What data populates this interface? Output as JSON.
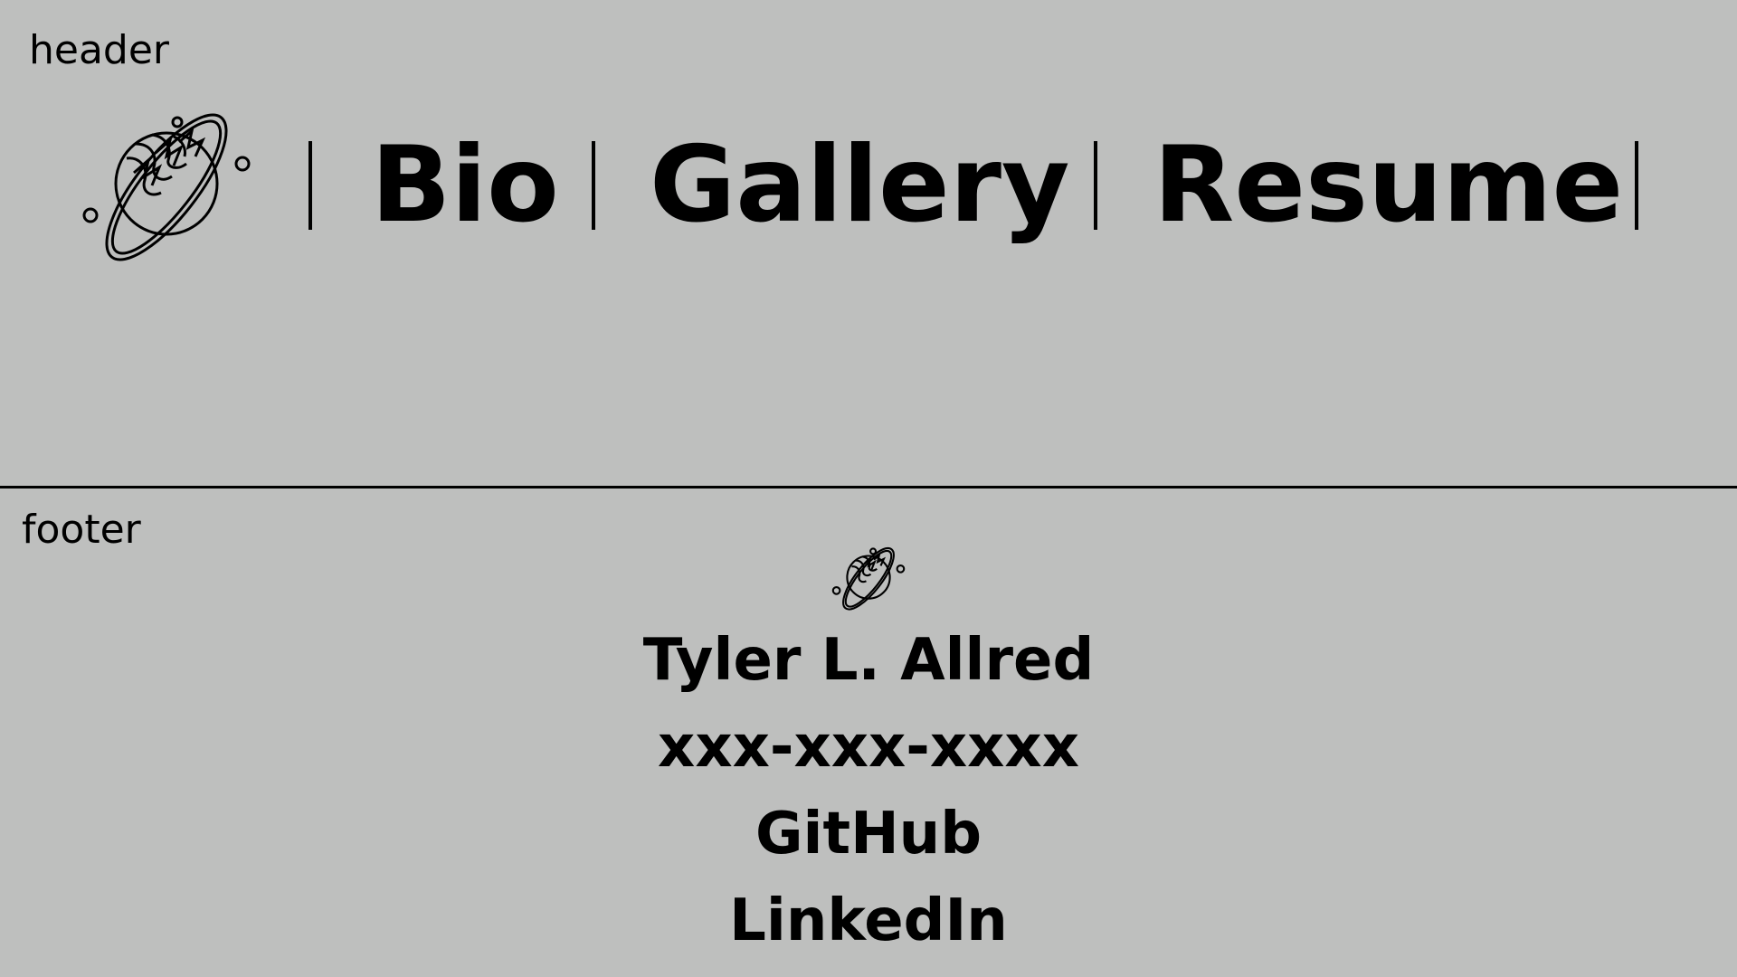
{
  "header": {
    "label": "header",
    "nav": {
      "items": [
        {
          "label": "Bio"
        },
        {
          "label": "Gallery"
        },
        {
          "label": "Resume"
        }
      ]
    }
  },
  "footer": {
    "label": "footer",
    "name": "Tyler L. Allred",
    "phone": "xxx-xxx-xxxx",
    "links": [
      {
        "label": "GitHub"
      },
      {
        "label": "LinkedIn"
      }
    ]
  },
  "icons": {
    "logo": "planet-icon"
  },
  "colors": {
    "background": "#bebfbe",
    "ink": "#000000"
  }
}
